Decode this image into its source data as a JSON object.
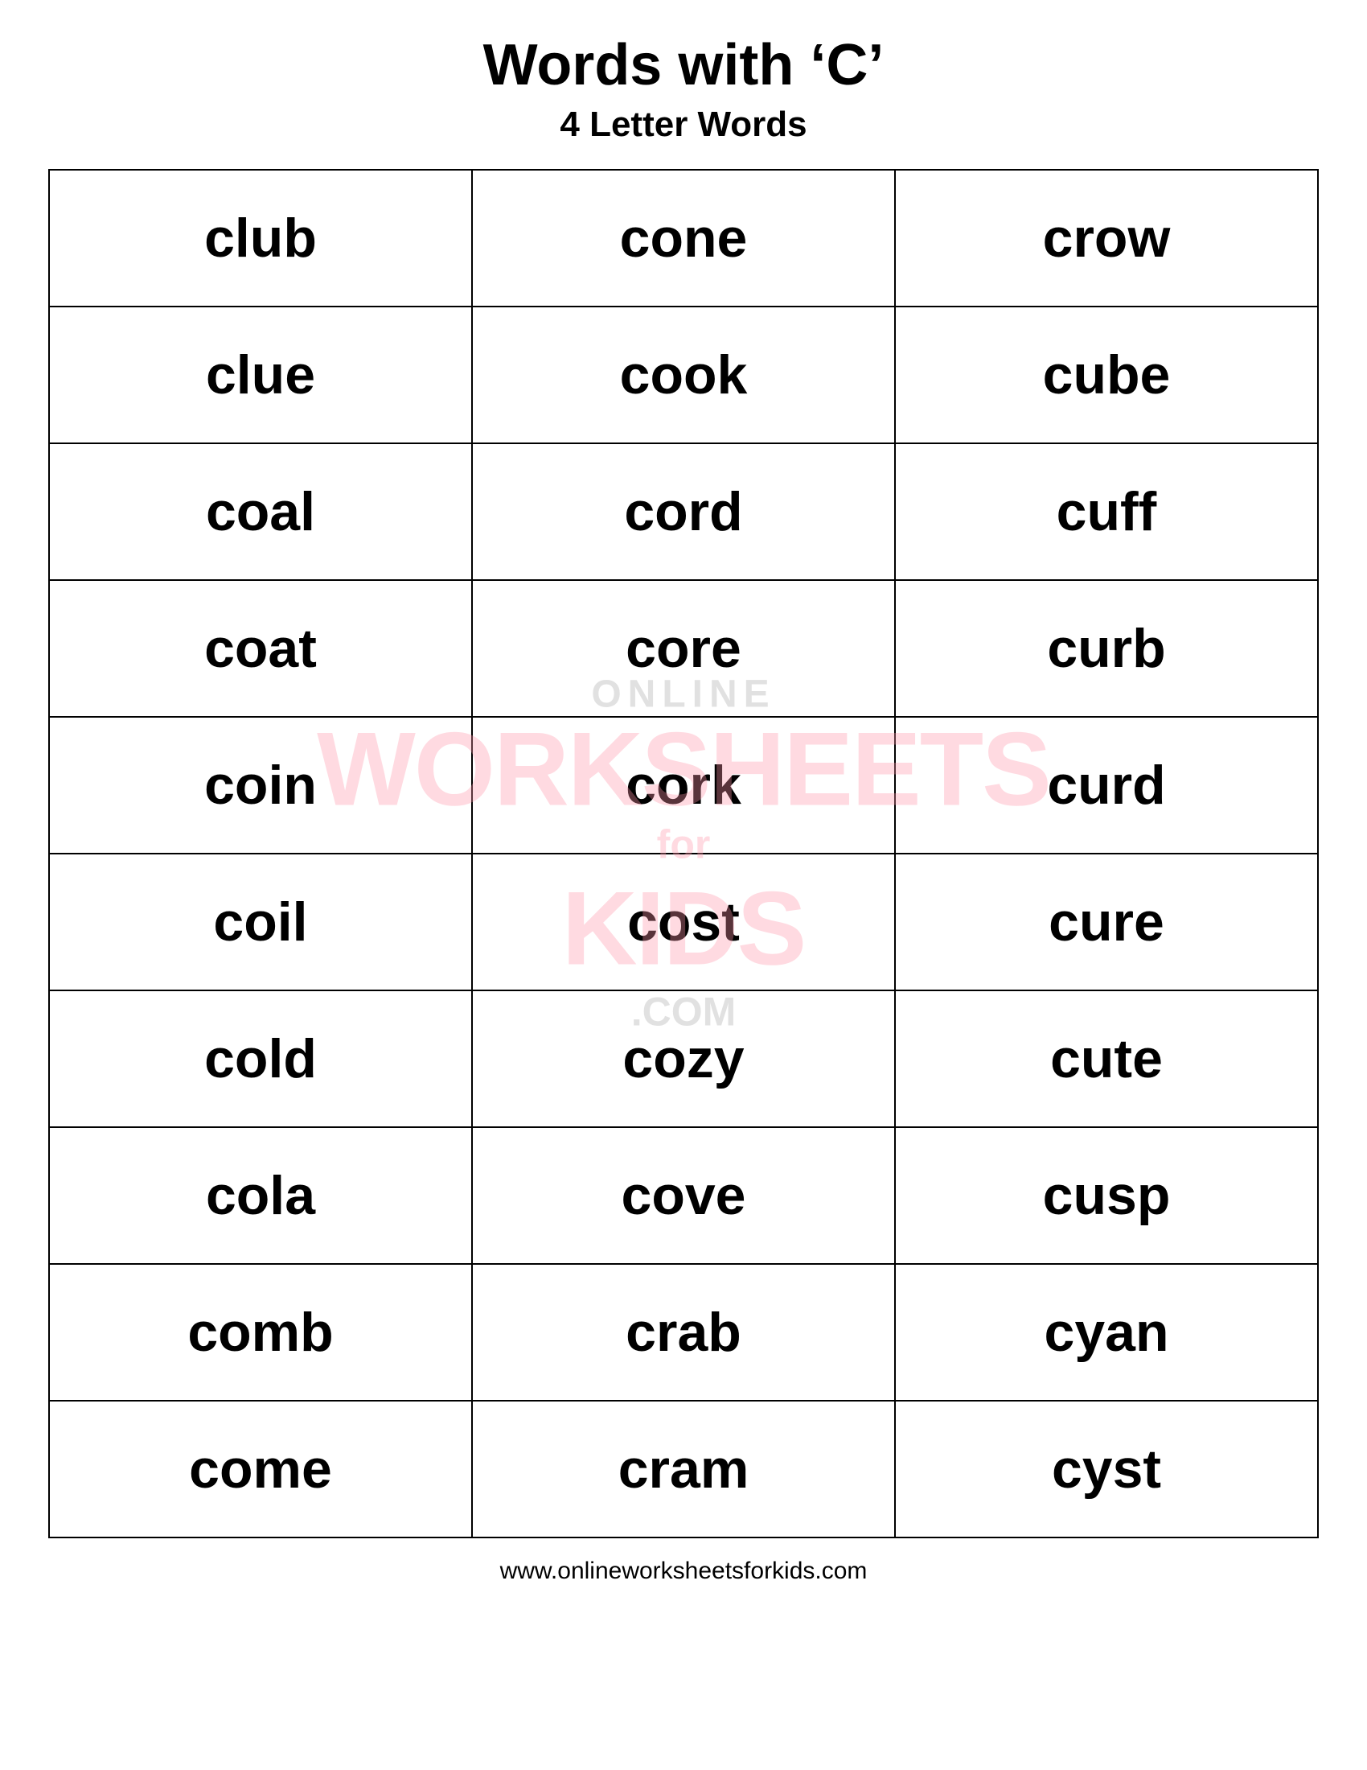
{
  "header": {
    "title": "Words with ‘C’",
    "subtitle": "4 Letter Words"
  },
  "table": {
    "rows": [
      [
        "club",
        "cone",
        "crow"
      ],
      [
        "clue",
        "cook",
        "cube"
      ],
      [
        "coal",
        "cord",
        "cuff"
      ],
      [
        "coat",
        "core",
        "curb"
      ],
      [
        "coin",
        "cork",
        "curd"
      ],
      [
        "coil",
        "cost",
        "cure"
      ],
      [
        "cold",
        "cozy",
        "cute"
      ],
      [
        "cola",
        "cove",
        "cusp"
      ],
      [
        "comb",
        "crab",
        "cyan"
      ],
      [
        "come",
        "cram",
        "cyst"
      ]
    ]
  },
  "watermark": {
    "online": "ONLINE",
    "worksheets": "WORKSHEETS",
    "for": "for",
    "kids": "KIDS",
    "com": ".COM"
  },
  "footer": {
    "url": "www.onlineworksheetsforkids.com"
  }
}
